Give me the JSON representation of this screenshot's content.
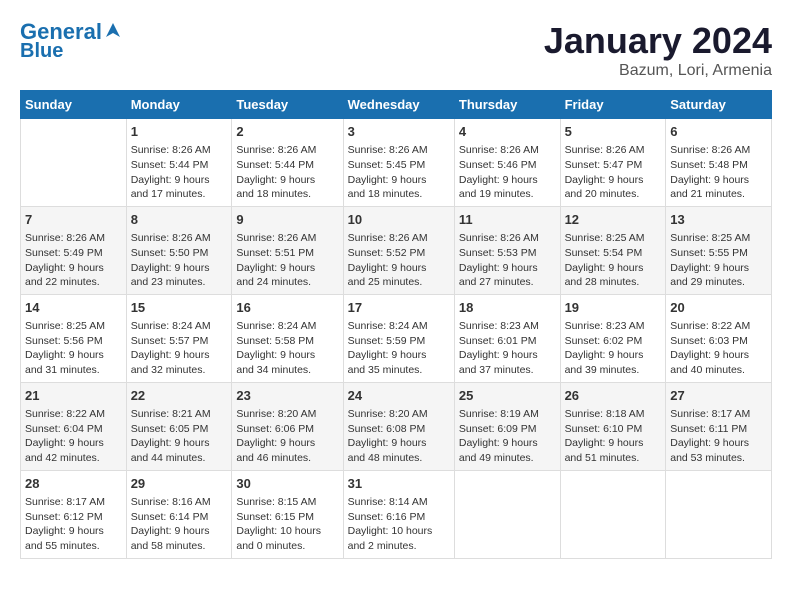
{
  "header": {
    "logo_line1": "General",
    "logo_line2": "Blue",
    "month_title": "January 2024",
    "location": "Bazum, Lori, Armenia"
  },
  "columns": [
    "Sunday",
    "Monday",
    "Tuesday",
    "Wednesday",
    "Thursday",
    "Friday",
    "Saturday"
  ],
  "weeks": [
    [
      {
        "day": "",
        "content": ""
      },
      {
        "day": "1",
        "content": "Sunrise: 8:26 AM\nSunset: 5:44 PM\nDaylight: 9 hours\nand 17 minutes."
      },
      {
        "day": "2",
        "content": "Sunrise: 8:26 AM\nSunset: 5:44 PM\nDaylight: 9 hours\nand 18 minutes."
      },
      {
        "day": "3",
        "content": "Sunrise: 8:26 AM\nSunset: 5:45 PM\nDaylight: 9 hours\nand 18 minutes."
      },
      {
        "day": "4",
        "content": "Sunrise: 8:26 AM\nSunset: 5:46 PM\nDaylight: 9 hours\nand 19 minutes."
      },
      {
        "day": "5",
        "content": "Sunrise: 8:26 AM\nSunset: 5:47 PM\nDaylight: 9 hours\nand 20 minutes."
      },
      {
        "day": "6",
        "content": "Sunrise: 8:26 AM\nSunset: 5:48 PM\nDaylight: 9 hours\nand 21 minutes."
      }
    ],
    [
      {
        "day": "7",
        "content": "Sunrise: 8:26 AM\nSunset: 5:49 PM\nDaylight: 9 hours\nand 22 minutes."
      },
      {
        "day": "8",
        "content": "Sunrise: 8:26 AM\nSunset: 5:50 PM\nDaylight: 9 hours\nand 23 minutes."
      },
      {
        "day": "9",
        "content": "Sunrise: 8:26 AM\nSunset: 5:51 PM\nDaylight: 9 hours\nand 24 minutes."
      },
      {
        "day": "10",
        "content": "Sunrise: 8:26 AM\nSunset: 5:52 PM\nDaylight: 9 hours\nand 25 minutes."
      },
      {
        "day": "11",
        "content": "Sunrise: 8:26 AM\nSunset: 5:53 PM\nDaylight: 9 hours\nand 27 minutes."
      },
      {
        "day": "12",
        "content": "Sunrise: 8:25 AM\nSunset: 5:54 PM\nDaylight: 9 hours\nand 28 minutes."
      },
      {
        "day": "13",
        "content": "Sunrise: 8:25 AM\nSunset: 5:55 PM\nDaylight: 9 hours\nand 29 minutes."
      }
    ],
    [
      {
        "day": "14",
        "content": "Sunrise: 8:25 AM\nSunset: 5:56 PM\nDaylight: 9 hours\nand 31 minutes."
      },
      {
        "day": "15",
        "content": "Sunrise: 8:24 AM\nSunset: 5:57 PM\nDaylight: 9 hours\nand 32 minutes."
      },
      {
        "day": "16",
        "content": "Sunrise: 8:24 AM\nSunset: 5:58 PM\nDaylight: 9 hours\nand 34 minutes."
      },
      {
        "day": "17",
        "content": "Sunrise: 8:24 AM\nSunset: 5:59 PM\nDaylight: 9 hours\nand 35 minutes."
      },
      {
        "day": "18",
        "content": "Sunrise: 8:23 AM\nSunset: 6:01 PM\nDaylight: 9 hours\nand 37 minutes."
      },
      {
        "day": "19",
        "content": "Sunrise: 8:23 AM\nSunset: 6:02 PM\nDaylight: 9 hours\nand 39 minutes."
      },
      {
        "day": "20",
        "content": "Sunrise: 8:22 AM\nSunset: 6:03 PM\nDaylight: 9 hours\nand 40 minutes."
      }
    ],
    [
      {
        "day": "21",
        "content": "Sunrise: 8:22 AM\nSunset: 6:04 PM\nDaylight: 9 hours\nand 42 minutes."
      },
      {
        "day": "22",
        "content": "Sunrise: 8:21 AM\nSunset: 6:05 PM\nDaylight: 9 hours\nand 44 minutes."
      },
      {
        "day": "23",
        "content": "Sunrise: 8:20 AM\nSunset: 6:06 PM\nDaylight: 9 hours\nand 46 minutes."
      },
      {
        "day": "24",
        "content": "Sunrise: 8:20 AM\nSunset: 6:08 PM\nDaylight: 9 hours\nand 48 minutes."
      },
      {
        "day": "25",
        "content": "Sunrise: 8:19 AM\nSunset: 6:09 PM\nDaylight: 9 hours\nand 49 minutes."
      },
      {
        "day": "26",
        "content": "Sunrise: 8:18 AM\nSunset: 6:10 PM\nDaylight: 9 hours\nand 51 minutes."
      },
      {
        "day": "27",
        "content": "Sunrise: 8:17 AM\nSunset: 6:11 PM\nDaylight: 9 hours\nand 53 minutes."
      }
    ],
    [
      {
        "day": "28",
        "content": "Sunrise: 8:17 AM\nSunset: 6:12 PM\nDaylight: 9 hours\nand 55 minutes."
      },
      {
        "day": "29",
        "content": "Sunrise: 8:16 AM\nSunset: 6:14 PM\nDaylight: 9 hours\nand 58 minutes."
      },
      {
        "day": "30",
        "content": "Sunrise: 8:15 AM\nSunset: 6:15 PM\nDaylight: 10 hours\nand 0 minutes."
      },
      {
        "day": "31",
        "content": "Sunrise: 8:14 AM\nSunset: 6:16 PM\nDaylight: 10 hours\nand 2 minutes."
      },
      {
        "day": "",
        "content": ""
      },
      {
        "day": "",
        "content": ""
      },
      {
        "day": "",
        "content": ""
      }
    ]
  ]
}
